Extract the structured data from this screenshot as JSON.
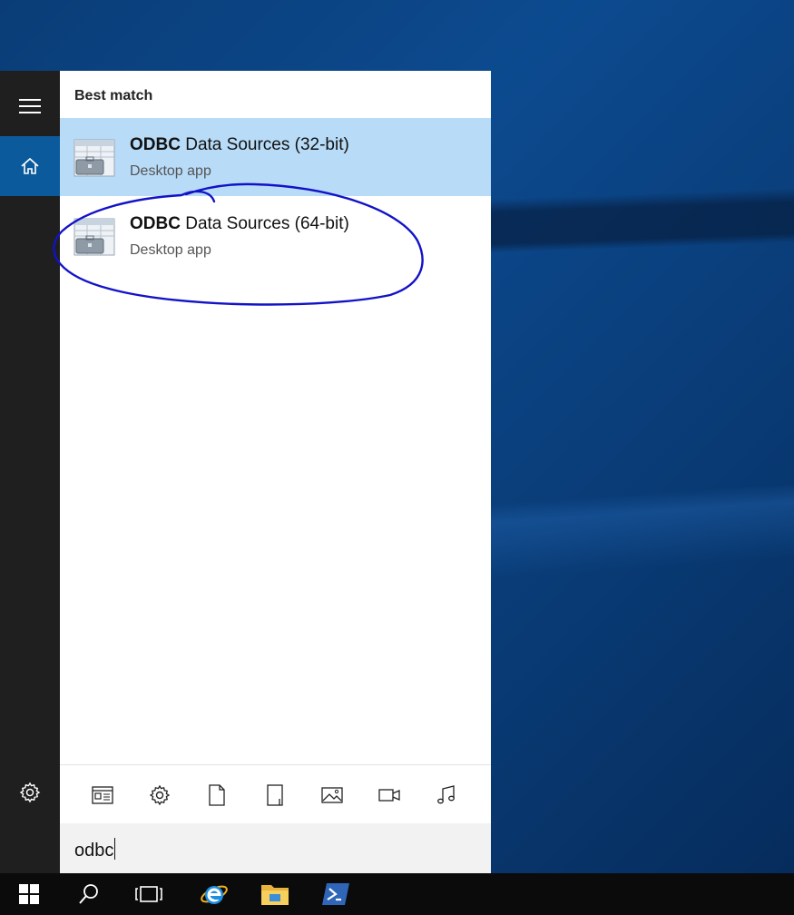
{
  "search_panel": {
    "section_title": "Best match",
    "results": [
      {
        "title_bold": "ODBC",
        "title_rest": " Data Sources (32-bit)",
        "subtitle": "Desktop app",
        "selected": true
      },
      {
        "title_bold": "ODBC",
        "title_rest": " Data Sources (64-bit)",
        "subtitle": "Desktop app",
        "selected": false
      }
    ],
    "filters": [
      "apps-filter-icon",
      "settings-filter-icon",
      "documents-filter-icon",
      "folders-filter-icon",
      "photos-filter-icon",
      "videos-filter-icon",
      "music-filter-icon"
    ],
    "query": "odbc"
  },
  "rail": {
    "icons": [
      "hamburger-menu-icon",
      "home-icon",
      "settings-gear-icon"
    ]
  },
  "taskbar": {
    "items": [
      "windows-start-icon",
      "search-icon",
      "task-view-icon",
      "internet-explorer-icon",
      "file-explorer-icon",
      "powershell-icon"
    ]
  },
  "colors": {
    "selected_row": "#b8dbf7",
    "home_active": "#0b5a9c",
    "annotation_ink": "#1212c8"
  }
}
